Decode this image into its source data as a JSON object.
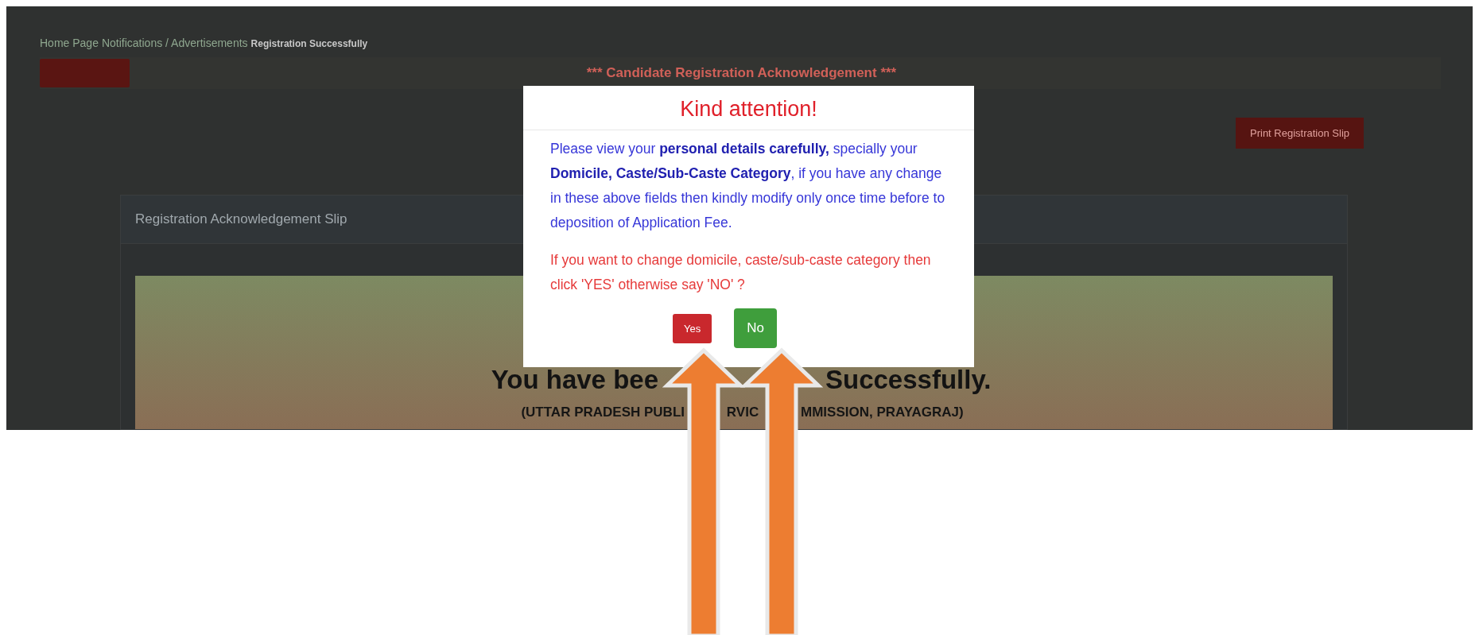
{
  "breadcrumb": [
    {
      "label": "Home Page",
      "current": false
    },
    {
      "label": "Notifications / Advertisements",
      "current": false
    },
    {
      "label": "Registration Successfully",
      "current": true
    }
  ],
  "heading": "*** Candidate Registration Acknowledgement ***",
  "print_button": "Print Registration Slip",
  "card": {
    "title": "Registration Acknowledgement Slip",
    "message_parts": [
      "You have bee",
      "Successfully."
    ],
    "organisation_parts": [
      "(UTTAR PRADESH PUBLI",
      "RVIC",
      "MMISSION, PRAYAGRAJ)"
    ]
  },
  "dialog": {
    "title": "Kind attention!",
    "body": "Please view your **personal details carefully,** specially your **Domicile, Caste/Sub-Caste Category**, if you have any change in these above fields then kindly modify only once time before to deposition of Application Fee.",
    "question": "If you want to change domicile, caste/sub-caste category then click 'YES' otherwise say 'NO' ?",
    "buttons": [
      {
        "label": "Yes",
        "kind": "danger"
      },
      {
        "label": "No",
        "kind": "success"
      }
    ]
  }
}
